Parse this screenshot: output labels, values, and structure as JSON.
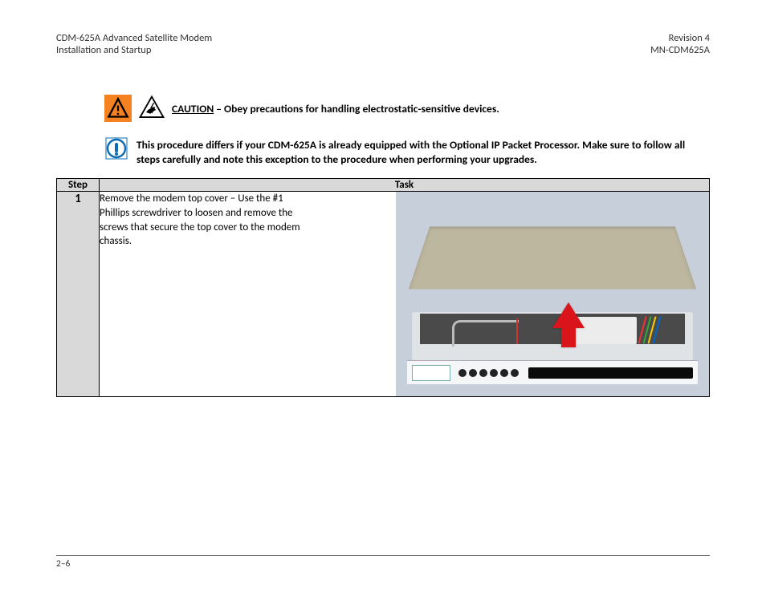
{
  "header": {
    "doc_title_line1": "CDM-625A Advanced Satellite Modem",
    "doc_title_line2": "Installation and Startup",
    "rev_line1": "Revision 4",
    "rev_line2": "MN-CDM625A"
  },
  "caution": {
    "word": "CAUTION",
    "text": " – Obey precautions for handling electrostatic-sensitive devices."
  },
  "info": {
    "text": "This procedure differs if your CDM-625A is already equipped with the Optional IP Packet Processor. Make sure to follow all steps carefully and note this exception to the procedure when performing your upgrades."
  },
  "table": {
    "headers": {
      "step": "Step",
      "task": "Task"
    },
    "row1": {
      "num": "1",
      "text": "Remove the modem top cover – Use the #1 Phillips screwdriver to loosen and remove the screws that secure the top cover to the modem chassis."
    }
  },
  "footer": {
    "pagenum": "2–6"
  }
}
